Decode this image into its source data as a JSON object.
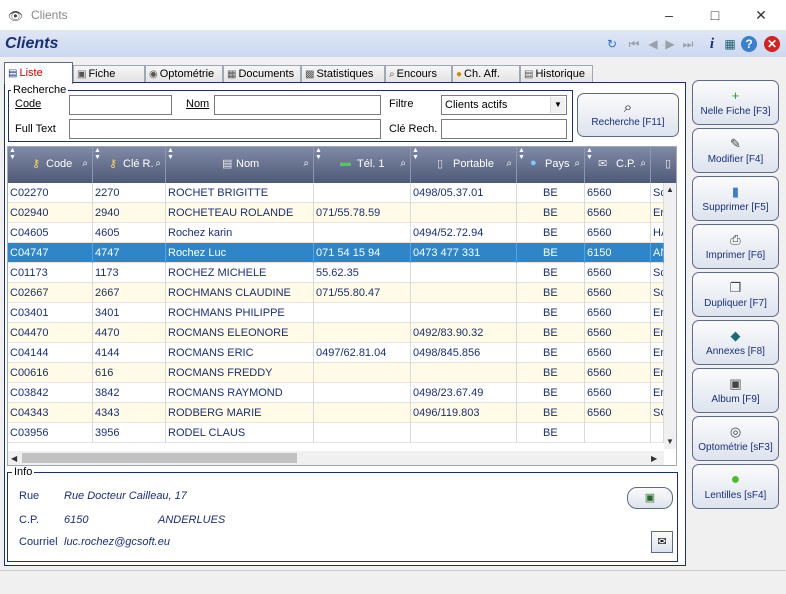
{
  "window": {
    "title": "Clients"
  },
  "header": {
    "title": "Clients"
  },
  "tabs": [
    {
      "label": "Liste",
      "icon": "list-icon"
    },
    {
      "label": "Fiche",
      "icon": "card-icon"
    },
    {
      "label": "Optométrie",
      "icon": "eye-icon"
    },
    {
      "label": "Documents",
      "icon": "documents-icon"
    },
    {
      "label": "Statistiques",
      "icon": "stats-icon"
    },
    {
      "label": "Encours",
      "icon": "search-doc-icon"
    },
    {
      "label": "Ch. Aff.",
      "icon": "coins-icon"
    },
    {
      "label": "Historique",
      "icon": "history-icon"
    }
  ],
  "search": {
    "group_label": "Recherche",
    "code_label": "Code",
    "code_value": "",
    "nom_label": "Nom",
    "nom_value": "",
    "filtre_label": "Filtre",
    "filtre_value": "Clients actifs",
    "fulltext_label": "Full Text",
    "fulltext_value": "",
    "cle_label": "Clé Rech.",
    "cle_value": "",
    "button_label": "Recherche [F11]"
  },
  "table": {
    "columns": [
      "Code",
      "Clé R.",
      "Nom",
      "Tél. 1",
      "Portable",
      "Pays",
      "C.P.",
      ""
    ],
    "rows": [
      [
        "C02270",
        "2270",
        "ROCHET BRIGITTE",
        "",
        "0498/05.37.01",
        "BE",
        "6560",
        "Sc"
      ],
      [
        "C02940",
        "2940",
        "ROCHETEAU ROLANDE",
        "071/55.78.59",
        "",
        "BE",
        "6560",
        "Er"
      ],
      [
        "C04605",
        "4605",
        "Rochez karin",
        "",
        "0494/52.72.94",
        "BE",
        "6560",
        "HA"
      ],
      [
        "C04747",
        "4747",
        "Rochez Luc",
        "071 54 15 94",
        "0473 477 331",
        "BE",
        "6150",
        "AN"
      ],
      [
        "C01173",
        "1173",
        "ROCHEZ MICHELE",
        "55.62.35",
        "",
        "BE",
        "6560",
        "Sc"
      ],
      [
        "C02667",
        "2667",
        "ROCHMANS CLAUDINE",
        "071/55.80.47",
        "",
        "BE",
        "6560",
        "Sc"
      ],
      [
        "C03401",
        "3401",
        "ROCHMANS PHILIPPE",
        "",
        "",
        "BE",
        "6560",
        "Er"
      ],
      [
        "C04470",
        "4470",
        "ROCMANS ELEONORE",
        "",
        "0492/83.90.32",
        "BE",
        "6560",
        "Er"
      ],
      [
        "C04144",
        "4144",
        "ROCMANS ERIC",
        "0497/62.81.04",
        "0498/845.856",
        "BE",
        "6560",
        "Er"
      ],
      [
        "C00616",
        "616",
        "ROCMANS FREDDY",
        "",
        "",
        "BE",
        "6560",
        "Er"
      ],
      [
        "C03842",
        "3842",
        "ROCMANS RAYMOND",
        "",
        "0498/23.67.49",
        "BE",
        "6560",
        "Er"
      ],
      [
        "C04343",
        "4343",
        "RODBERG MARIE",
        "",
        "0496/119.803",
        "BE",
        "6560",
        "SC"
      ],
      [
        "C03956",
        "3956",
        "RODEL CLAUS",
        "",
        "",
        "BE",
        "",
        ""
      ]
    ],
    "selected_row": 3
  },
  "info": {
    "group_label": "Info",
    "rue_label": "Rue",
    "rue_value": "Rue Docteur Cailleau, 17",
    "cp_label": "C.P.",
    "cp_value": "6150",
    "city_value": "ANDERLUES",
    "courriel_label": "Courriel",
    "courriel_value": "luc.rochez@gcsoft.eu"
  },
  "side_buttons": [
    {
      "label": "Nelle Fiche [F3]",
      "icon": "new-file-icon"
    },
    {
      "label": "Modifier [F4]",
      "icon": "edit-icon"
    },
    {
      "label": "Supprimer [F5]",
      "icon": "trash-icon"
    },
    {
      "label": "Imprimer [F6]",
      "icon": "printer-icon"
    },
    {
      "label": "Dupliquer [F7]",
      "icon": "duplicate-icon"
    },
    {
      "label": "Annexes [F8]",
      "icon": "book-icon"
    },
    {
      "label": "Album [F9]",
      "icon": "album-icon"
    },
    {
      "label": "Optométrie [sF3]",
      "icon": "glasses-icon"
    },
    {
      "label": "Lentilles [sF4]",
      "icon": "lens-icon"
    }
  ]
}
